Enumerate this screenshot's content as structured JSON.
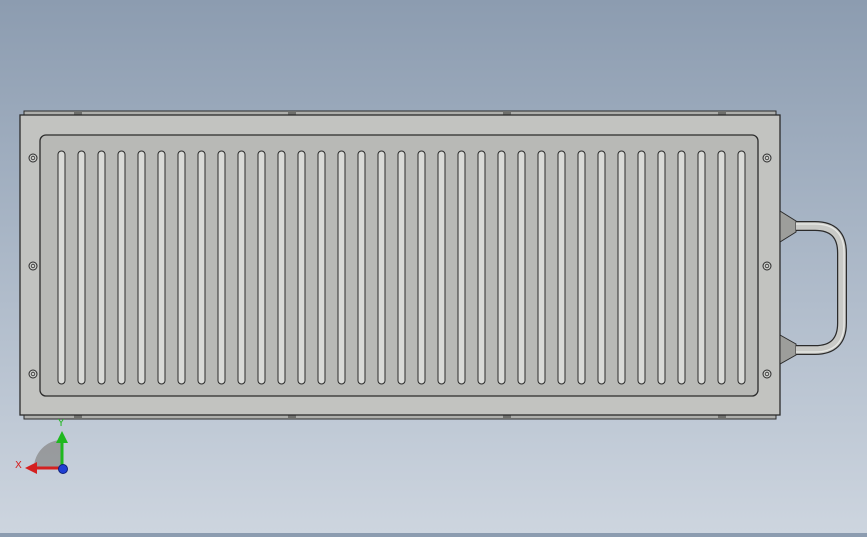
{
  "viewport": {
    "background_top": "#8c9cb0",
    "background_bottom": "#cdd5df"
  },
  "model": {
    "plate_color": "#c2c3c0",
    "panel_color": "#b8b9b6",
    "edge_color": "#2b2b2b",
    "slot_count": 35,
    "bolt_holes_per_side": 3,
    "has_handle": true
  },
  "triad": {
    "x_label": "X",
    "y_label": "Y",
    "x_color": "#d42020",
    "y_color": "#1fb81f",
    "z_color": "#1f3fd4"
  }
}
